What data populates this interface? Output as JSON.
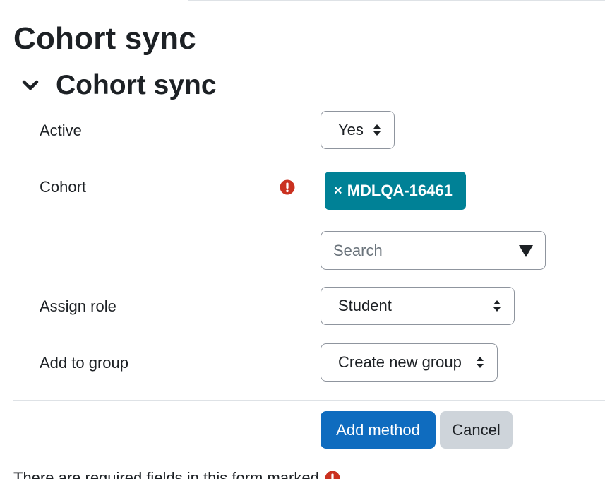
{
  "page": {
    "title": "Cohort sync"
  },
  "section": {
    "title": "Cohort sync"
  },
  "form": {
    "active": {
      "label": "Active",
      "value": "Yes"
    },
    "cohort": {
      "label": "Cohort",
      "selected": "MDLQA-16461",
      "remove_glyph": "×",
      "search_placeholder": "Search"
    },
    "assign_role": {
      "label": "Assign role",
      "value": "Student"
    },
    "add_to_group": {
      "label": "Add to group",
      "value": "Create new group"
    }
  },
  "buttons": {
    "submit": "Add method",
    "cancel": "Cancel"
  },
  "footer": {
    "required_note": "There are required fields in this form marked"
  },
  "colors": {
    "primary": "#0f6cbf",
    "chip": "#008196",
    "required": "#ca3120",
    "secondary_button": "#ced4da"
  },
  "icons": {
    "section_toggle": "chevron-down-icon",
    "required": "exclamation-circle-icon",
    "select_arrows": "sort-arrows-icon",
    "dropdown": "triangle-down-icon"
  }
}
